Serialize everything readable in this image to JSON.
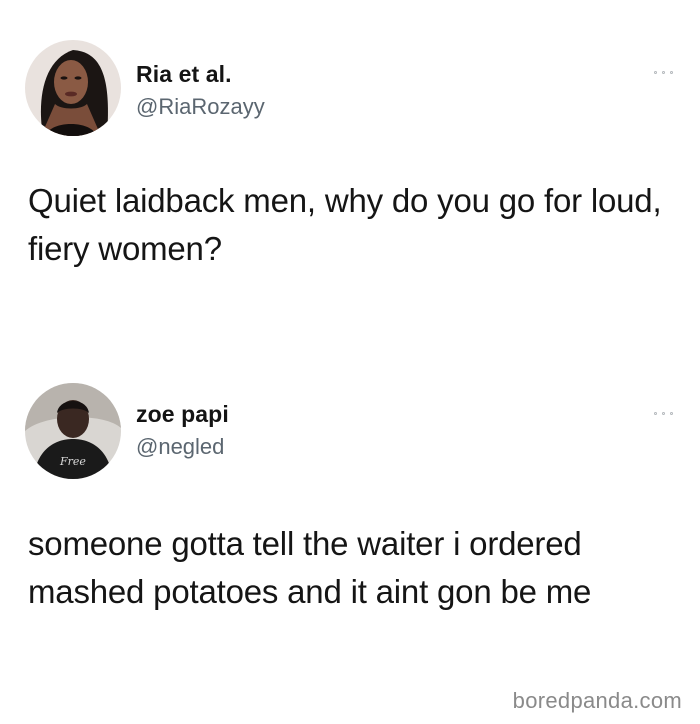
{
  "tweets": [
    {
      "author": {
        "name": "Ria et al.",
        "handle": "@RiaRozayy"
      },
      "text": "Quiet laidback men, why do you go for loud, fiery women?"
    },
    {
      "author": {
        "name": "zoe papi",
        "handle": "@negled"
      },
      "text": "someone gotta tell the waiter i ordered mashed potatoes and it aint gon be me"
    }
  ],
  "watermark": "boredpanda.com",
  "icons": {
    "more": "more-options-icon"
  },
  "colors": {
    "background": "#ffffff",
    "name": "#141414",
    "handle": "#5b6670",
    "body_text": "#151515",
    "watermark": "#8a8a8a"
  }
}
